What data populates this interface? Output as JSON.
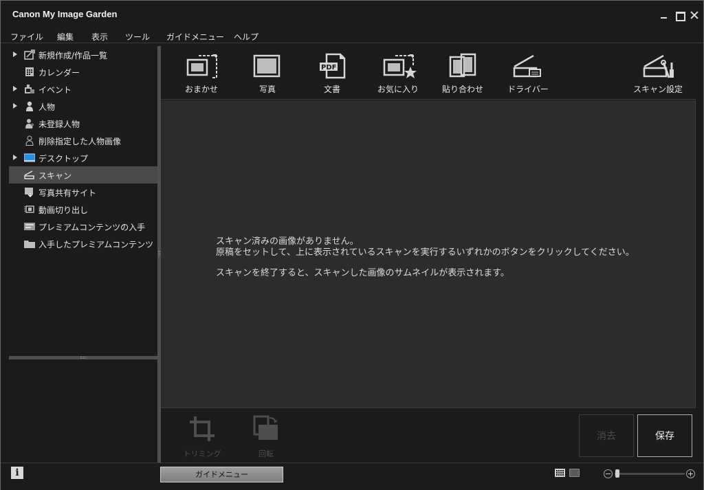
{
  "window": {
    "title": "Canon My Image Garden"
  },
  "menu": [
    "ファイル",
    "編集",
    "表示",
    "ツール",
    "ガイドメニュー",
    "ヘルプ"
  ],
  "sidebar": {
    "items": [
      {
        "label": "新規作成/作品一覧",
        "icon": "new-work-icon",
        "expandable": true
      },
      {
        "label": "カレンダー",
        "icon": "calendar-icon",
        "expandable": false
      },
      {
        "label": "イベント",
        "icon": "event-icon",
        "expandable": true
      },
      {
        "label": "人物",
        "icon": "person-icon",
        "expandable": true
      },
      {
        "label": "未登録人物",
        "icon": "unregistered-person-icon",
        "expandable": false
      },
      {
        "label": "削除指定した人物画像",
        "icon": "deleted-person-icon",
        "expandable": false
      },
      {
        "label": "デスクトップ",
        "icon": "desktop-icon",
        "expandable": true
      },
      {
        "label": "スキャン",
        "icon": "scan-icon",
        "expandable": false,
        "selected": true
      },
      {
        "label": "写真共有サイト",
        "icon": "photo-share-icon",
        "expandable": false
      },
      {
        "label": "動画切り出し",
        "icon": "video-capture-icon",
        "expandable": false
      },
      {
        "label": "プレミアムコンテンツの入手",
        "icon": "premium-download-icon",
        "expandable": false
      },
      {
        "label": "入手したプレミアムコンテンツ",
        "icon": "folder-icon",
        "expandable": false
      }
    ]
  },
  "toolbar": {
    "auto": "おまかせ",
    "photo": "写真",
    "document": "文書",
    "favorite": "お気に入り",
    "stitch": "貼り合わせ",
    "driver": "ドライバー",
    "settings": "スキャン設定",
    "pdf_glyph": "PDF"
  },
  "content": {
    "line1": "スキャン済みの画像がありません。",
    "line2": "原稿をセットして、上に表示されているスキャンを実行するいずれかのボタンをクリックしてください。",
    "line3": "スキャンを終了すると、スキャンした画像のサムネイルが表示されます。"
  },
  "bottom": {
    "trim": "トリミング",
    "rotate": "回転",
    "delete": "消去",
    "save": "保存"
  },
  "status": {
    "info": "i",
    "guide": "ガイドメニュー"
  }
}
